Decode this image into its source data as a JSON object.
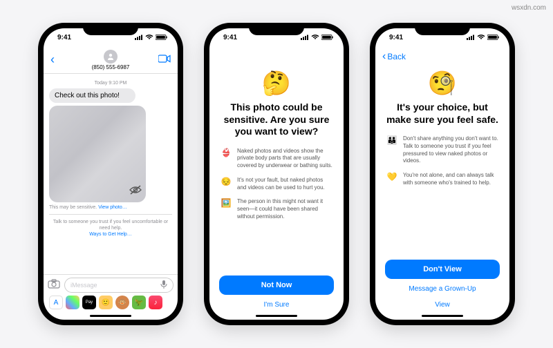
{
  "watermark": "wsxdn.com",
  "status": {
    "time": "9:41"
  },
  "phone1": {
    "contact": "(850) 555-6987",
    "timestamp": "Today 9:10 PM",
    "message": "Check out this photo!",
    "sensitive_label": "This may be sensitive.",
    "view_link": "View photo…",
    "help_text": "Talk to someone you trust if you feel uncomfortable or need help.",
    "help_link": "Ways to Get Help…",
    "placeholder": "iMessage"
  },
  "phone2": {
    "emoji": "🤔",
    "title": "This photo could be sensitive. Are you sure you want to view?",
    "bullets": [
      {
        "emoji": "👙",
        "text": "Naked photos and videos show the private body parts that are usually covered by underwear or bathing suits."
      },
      {
        "emoji": "😔",
        "text": "It's not your fault, but naked photos and videos can be used to hurt you."
      },
      {
        "emoji": "🖼️",
        "text": "The person in this might not want it seen—it could have been shared without permission."
      }
    ],
    "primary": "Not Now",
    "secondary": "I'm Sure"
  },
  "phone3": {
    "back": "Back",
    "emoji": "🧐",
    "title": "It's your choice, but make sure you feel safe.",
    "bullets": [
      {
        "emoji": "👪",
        "text": "Don't share anything you don't want to. Talk to someone you trust if you feel pressured to view naked photos or videos."
      },
      {
        "emoji": "💛",
        "text": "You're not alone, and can always talk with someone who's trained to help."
      }
    ],
    "primary": "Don't View",
    "secondary1": "Message a Grown-Up",
    "secondary2": "View"
  }
}
